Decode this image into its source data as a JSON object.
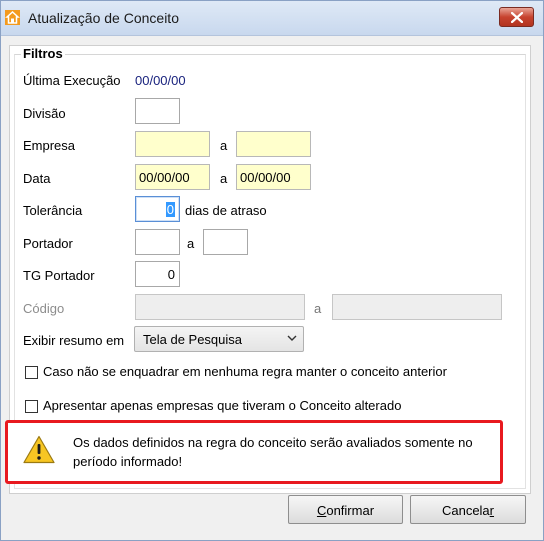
{
  "window": {
    "title": "Atualização de Conceito",
    "icon": "app-logo-icon",
    "close_icon": "close-icon"
  },
  "filters": {
    "legend": "Filtros",
    "ultima_execucao": {
      "label": "Última Execução",
      "value": "00/00/00"
    },
    "divisao": {
      "label": "Divisão",
      "value": ""
    },
    "empresa": {
      "label": "Empresa",
      "from": "",
      "sep": "a",
      "to": ""
    },
    "data": {
      "label": "Data",
      "from": "00/00/00",
      "sep": "a",
      "to": "00/00/00"
    },
    "tolerancia": {
      "label": "Tolerância",
      "value": "0",
      "suffix": "dias de atraso"
    },
    "portador": {
      "label": "Portador",
      "from": "",
      "sep": "a",
      "to": ""
    },
    "tg_portador": {
      "label": "TG Portador",
      "value": "0"
    },
    "codigo": {
      "label": "Código",
      "from": "",
      "sep": "a",
      "to": ""
    },
    "exibir_resumo": {
      "label": "Exibir resumo em",
      "selected": "Tela de Pesquisa"
    },
    "checkbox_manter": {
      "label": "Caso não se enquadrar em nenhuma regra manter o conceito anterior",
      "checked": false
    },
    "checkbox_apenas": {
      "label": "Apresentar apenas empresas que tiveram o Conceito alterado",
      "checked": false
    }
  },
  "warning": {
    "icon": "warning-icon",
    "text": "Os dados definidos na regra do conceito serão avaliados somente no período informado!",
    "highlight_color": "#e8191f"
  },
  "buttons": {
    "confirm_prefix": "",
    "confirm_accel": "C",
    "confirm_rest": "onfirmar",
    "cancel_prefix": "Cancela",
    "cancel_accel": "r",
    "cancel_rest": ""
  }
}
